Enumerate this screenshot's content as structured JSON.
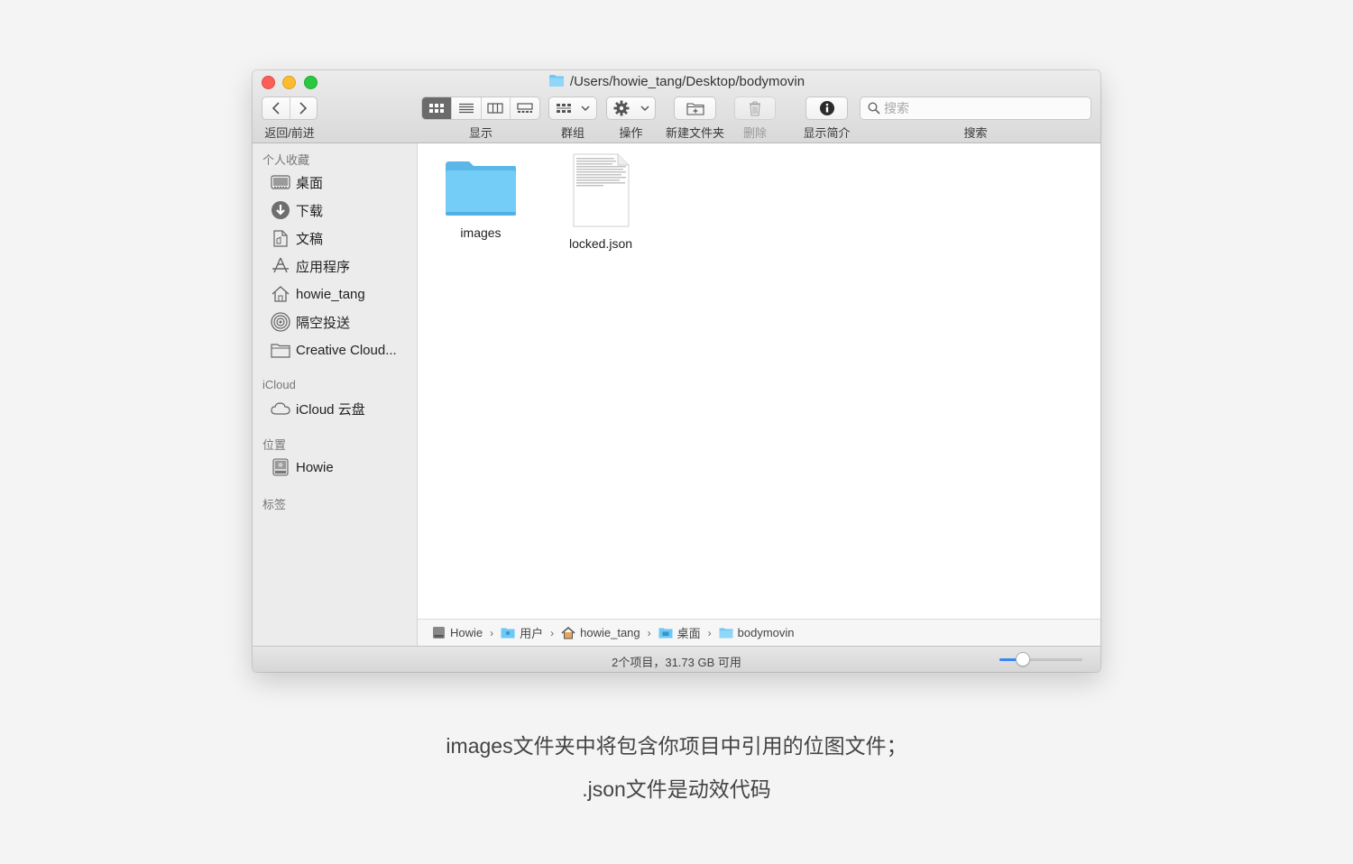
{
  "window": {
    "title": "/Users/howie_tang/Desktop/bodymovin"
  },
  "toolbar": {
    "back_forward_label": "返回/前进",
    "view_label": "显示",
    "group_label": "群组",
    "action_label": "操作",
    "new_folder_label": "新建文件夹",
    "delete_label": "删除",
    "info_label": "显示简介",
    "search_label": "搜索",
    "search_placeholder": "搜索"
  },
  "sidebar": {
    "favorites_title": "个人收藏",
    "favorites": [
      {
        "label": "桌面",
        "icon": "desktop-icon"
      },
      {
        "label": "下载",
        "icon": "download-icon"
      },
      {
        "label": "文稿",
        "icon": "documents-icon"
      },
      {
        "label": "应用程序",
        "icon": "applications-icon"
      },
      {
        "label": "howie_tang",
        "icon": "home-icon"
      },
      {
        "label": "隔空投送",
        "icon": "airdrop-icon"
      },
      {
        "label": "Creative Cloud...",
        "icon": "folder-icon"
      }
    ],
    "icloud_title": "iCloud",
    "icloud": [
      {
        "label": "iCloud 云盘",
        "icon": "cloud-icon"
      }
    ],
    "locations_title": "位置",
    "locations": [
      {
        "label": "Howie",
        "icon": "disk-icon"
      }
    ],
    "tags_title": "标签"
  },
  "files": [
    {
      "name": "images",
      "icon": "folder-icon"
    },
    {
      "name": "locked.json",
      "icon": "document-icon"
    }
  ],
  "pathbar": [
    {
      "label": "Howie",
      "icon": "disk-icon"
    },
    {
      "label": "用户",
      "icon": "users-folder-icon"
    },
    {
      "label": "howie_tang",
      "icon": "home-icon"
    },
    {
      "label": "桌面",
      "icon": "desktop-folder-icon"
    },
    {
      "label": "bodymovin",
      "icon": "folder-icon"
    }
  ],
  "status": {
    "text": "2个项目，31.73 GB 可用",
    "icon_size_fraction": 0.28
  },
  "caption": {
    "line1": "images文件夹中将包含你项目中引用的位图文件；",
    "line2": ".json文件是动效代码"
  },
  "colors": {
    "folder": "#6cc8f4",
    "accent": "#3a86f5",
    "close": "#fc5f57",
    "minimize": "#fdbc2e",
    "zoom": "#2ac840"
  }
}
